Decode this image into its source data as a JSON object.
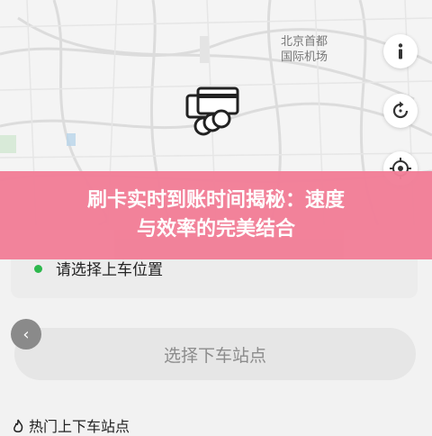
{
  "map": {
    "airport_label_line1": "北京首都",
    "airport_label_line2": "国际机场"
  },
  "map_controls": {
    "info_icon": "info-icon",
    "refresh_icon": "refresh-icon",
    "locate_icon": "locate-icon"
  },
  "banner": {
    "line1": "刷卡实时到账时间揭秘：速度",
    "line2": "与效率的完美结合",
    "color": "#f27f98"
  },
  "pickup": {
    "label": "请选择上车位置",
    "dot_color": "#2db84d"
  },
  "destination": {
    "placeholder": "选择下车站点"
  },
  "hot_stations": {
    "title": "热门上下车站点"
  }
}
